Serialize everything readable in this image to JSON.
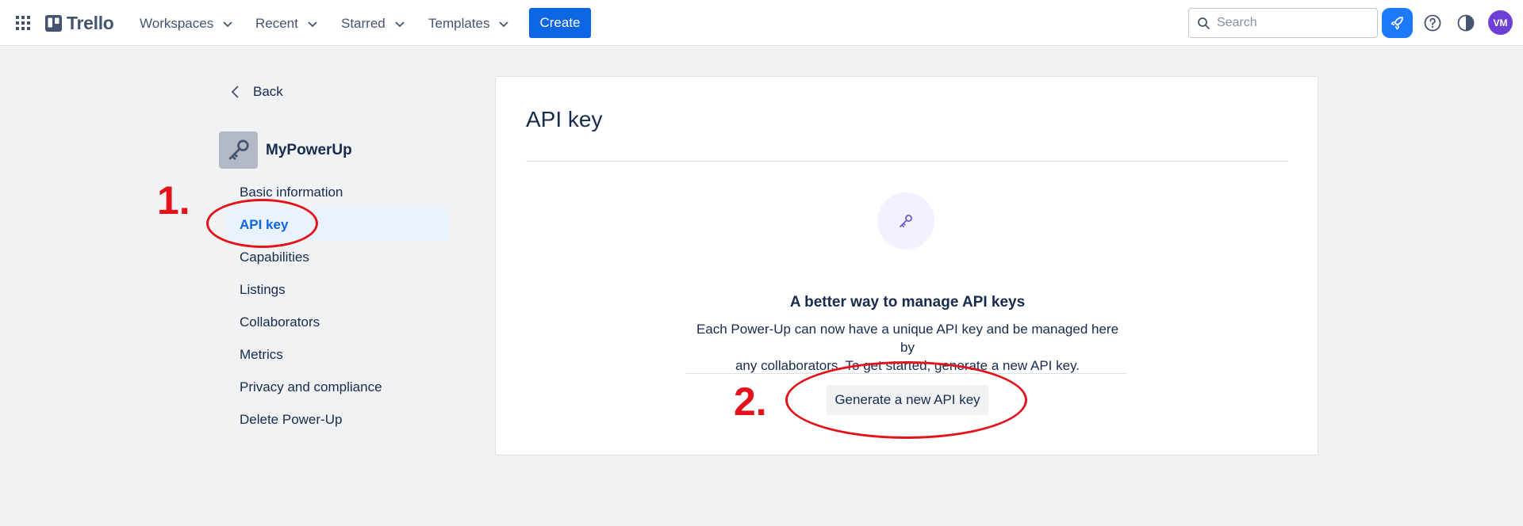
{
  "header": {
    "brand": "Trello",
    "nav": [
      {
        "label": "Workspaces"
      },
      {
        "label": "Recent"
      },
      {
        "label": "Starred"
      },
      {
        "label": "Templates"
      }
    ],
    "create_label": "Create",
    "search_placeholder": "Search",
    "avatar_initials": "VM",
    "accent_color": "#0c66e4"
  },
  "sidebar": {
    "back_label": "Back",
    "powerup_name": "MyPowerUp",
    "items": [
      {
        "label": "Basic information",
        "active": false
      },
      {
        "label": "API key",
        "active": true
      },
      {
        "label": "Capabilities",
        "active": false
      },
      {
        "label": "Listings",
        "active": false
      },
      {
        "label": "Collaborators",
        "active": false
      },
      {
        "label": "Metrics",
        "active": false
      },
      {
        "label": "Privacy and compliance",
        "active": false
      },
      {
        "label": "Delete Power-Up",
        "active": false
      }
    ]
  },
  "main": {
    "title": "API key",
    "empty_heading": "A better way to manage API keys",
    "empty_description_line1": "Each Power-Up can now have a unique API key and be managed here by",
    "empty_description_line2": "any collaborators. To get started, generate a new API key.",
    "generate_button": "Generate a new API key"
  },
  "annotations": {
    "step1": "1.",
    "step2": "2.",
    "color": "#e3121b"
  }
}
